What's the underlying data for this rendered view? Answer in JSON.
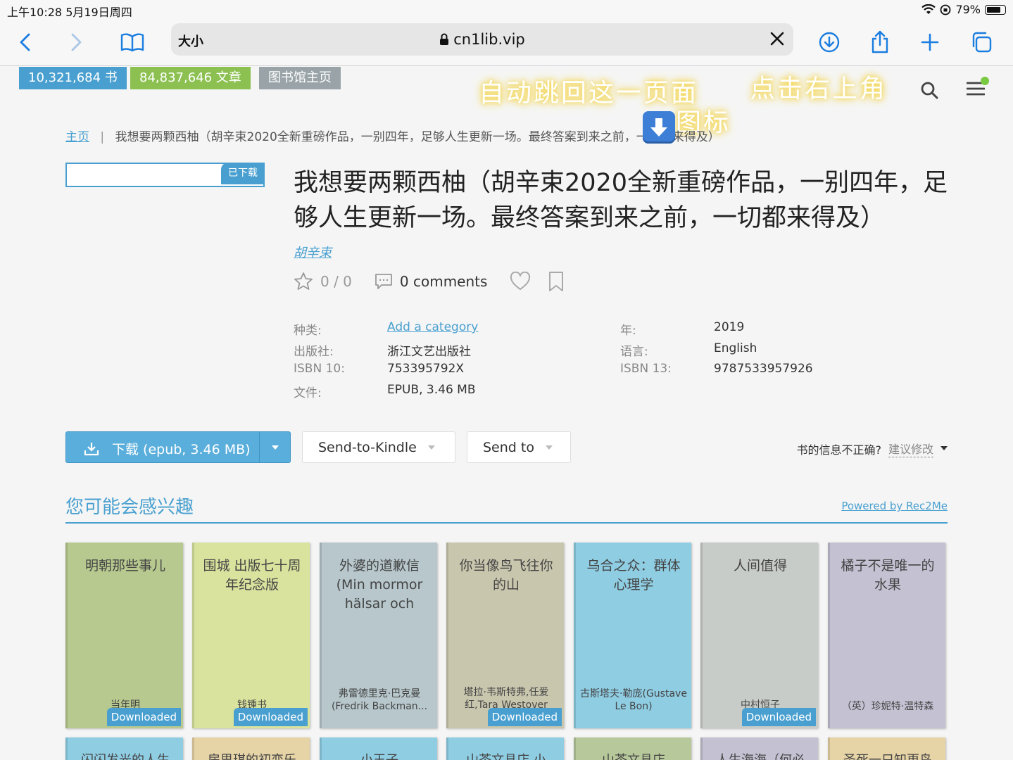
{
  "status_bar": {
    "time": "上午10:28   5月19日周四",
    "battery": "79%",
    "battery_level": 0.79
  },
  "browser": {
    "text_size": "大小",
    "url": "cn1lib.vip"
  },
  "counters": {
    "books": "10,321,684 书",
    "articles": "84,837,646 文章",
    "library_home": "图书馆主页"
  },
  "annotation": {
    "line1": "自动跳回这一页面",
    "line2": "点击右上角",
    "line3": "图标"
  },
  "breadcrumb": {
    "home": "主页",
    "separator": "|",
    "current": "我想要两颗西柚（胡辛束2020全新重磅作品，一别四年，足够人生更新一场。最终答案到来之前，一切都来得及）"
  },
  "book": {
    "downloaded_tag": "已下载",
    "title": "我想要两颗西柚（胡辛束2020全新重磅作品，一别四年，足够人生更新一场。最终答案到来之前，一切都来得及）",
    "author": "胡辛束",
    "rating": "0 / 0",
    "comments": "0 comments"
  },
  "details_left": [
    {
      "key": "种类:",
      "value": "Add a category"
    },
    {
      "key": "出版社:",
      "value": "浙江文艺出版社"
    },
    {
      "key": "ISBN 10:",
      "value": "753395792X"
    },
    {
      "key": "文件:",
      "value": "EPUB, 3.46 MB"
    }
  ],
  "details_right": [
    {
      "key": "年:",
      "value": "2019"
    },
    {
      "key": "语言:",
      "value": "English"
    },
    {
      "key": "ISBN 13:",
      "value": "9787533957926"
    }
  ],
  "actions": {
    "download": "下载 (epub, 3.46 MB)",
    "send_to_kindle": "Send-to-Kindle",
    "send_to": "Send to",
    "incorrect_info": "书的信息不正确?",
    "suggest_edit": "建议修改"
  },
  "recommend": {
    "title": "您可能会感兴趣",
    "powered": "Powered by Rec2Me",
    "downloaded_label": "Downloaded",
    "books": [
      {
        "title": "明朝那些事儿",
        "author": "当年明",
        "downloaded": true,
        "color": "#b7c98f"
      },
      {
        "title": "围城 出版七十周年纪念版",
        "author": "钱锺书",
        "downloaded": true,
        "color": "#d9e39e"
      },
      {
        "title": "外婆的道歉信(Min mormor hälsar och",
        "author": "弗雷德里克·巴克曼(Fredrik Backman...",
        "downloaded": false,
        "color": "#b7c7cc"
      },
      {
        "title": "你当像鸟飞往你的山",
        "author": "塔拉·韦斯特弗,任爱红,Tara Westover",
        "downloaded": true,
        "color": "#c9c6ae"
      },
      {
        "title": "乌合之众：群体心理学",
        "author": "古斯塔夫·勒庞(Gustave Le Bon)",
        "downloaded": false,
        "color": "#8fcde3"
      },
      {
        "title": "人间值得",
        "author": "中村恒子",
        "downloaded": true,
        "color": "#c8ccc8"
      },
      {
        "title": "橘子不是唯一的水果",
        "author": "（英）珍妮特·温特森",
        "downloaded": false,
        "color": "#c3c1d2"
      }
    ],
    "books_row2": [
      {
        "title": "闪闪发光的人生",
        "color": "#8fcde3"
      },
      {
        "title": "房思琪的初恋乐",
        "color": "#e6d3a6"
      },
      {
        "title": "小王子",
        "color": "#8fcde3"
      },
      {
        "title": "山茶文具店 小",
        "color": "#8fcde3"
      },
      {
        "title": "山茶文具店",
        "color": "#b7c99b"
      },
      {
        "title": "人生海海（何必",
        "color": "#c3c1d2"
      },
      {
        "title": "圣死一只知更鸟",
        "color": "#e6d3a6"
      }
    ]
  },
  "colors": {
    "accent": "#49a0d0",
    "books_badge": "#49a0d0",
    "articles_badge": "#8cc152",
    "library_badge": "#9aa4a8"
  }
}
